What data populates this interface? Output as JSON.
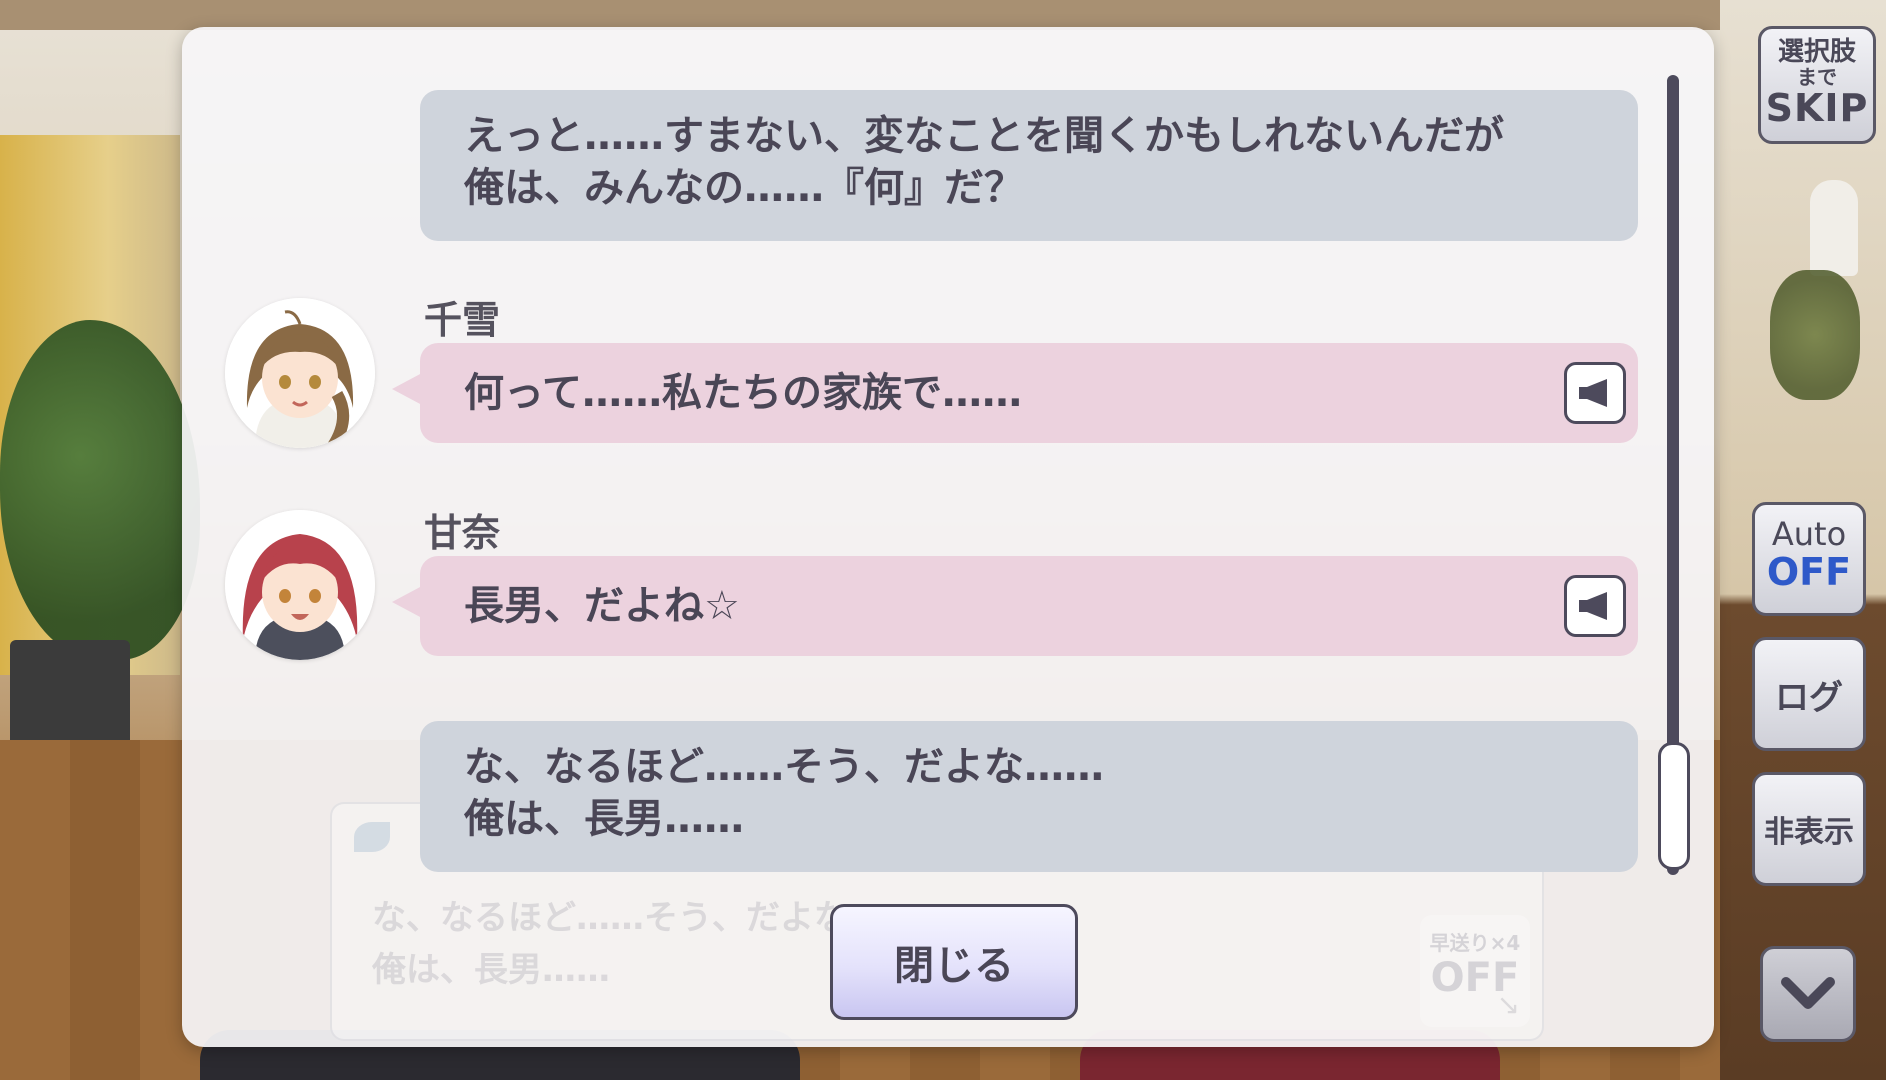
{
  "log": {
    "entries": [
      {
        "type": "self",
        "text": "えっと……すまない、変なことを聞くかもしれないんだが\n俺は、みんなの……『何』だ？"
      },
      {
        "type": "npc",
        "speaker": "千雪",
        "text": "何って……私たちの家族で……"
      },
      {
        "type": "npc",
        "speaker": "甘奈",
        "text": "長男、だよね☆"
      },
      {
        "type": "self",
        "text": "な、なるほど……そう、だよな……\n俺は、長男……"
      }
    ],
    "close_label": "閉じる"
  },
  "background_textbox": {
    "text": "な、なるほど……そう、だよな……\n俺は、長男……",
    "fast_forward_label": "早送り×4",
    "fast_forward_state": "OFF"
  },
  "controls": {
    "skip": {
      "line1": "選択肢",
      "line2": "まで",
      "line3": "SKIP"
    },
    "auto": {
      "label": "Auto",
      "state": "OFF"
    },
    "log_label": "ログ",
    "hide_label": "非表示"
  },
  "icons": {
    "voice": "speaker-icon",
    "down": "chevron-down-icon"
  },
  "colors": {
    "self_bubble": "#cfd4dc",
    "npc_bubble": "#ecd2de",
    "auto_state": "#2e59c9"
  }
}
